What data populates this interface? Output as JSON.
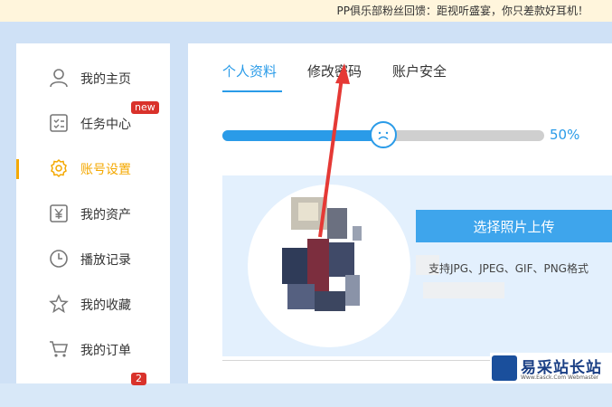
{
  "banner": {
    "text": "PP俱乐部粉丝回馈：距视听盛宴，你只差款好耳机！"
  },
  "sidebar": {
    "items": [
      {
        "label": "我的主页",
        "icon": "user-icon"
      },
      {
        "label": "任务中心",
        "icon": "task-list-icon",
        "badge": "new"
      },
      {
        "label": "账号设置",
        "icon": "gear-icon",
        "active": true
      },
      {
        "label": "我的资产",
        "icon": "yuan-wallet-icon"
      },
      {
        "label": "播放记录",
        "icon": "clock-icon"
      },
      {
        "label": "我的收藏",
        "icon": "star-icon"
      },
      {
        "label": "我的订单",
        "icon": "cart-icon"
      }
    ],
    "partial_badge": "2"
  },
  "main": {
    "tabs": [
      {
        "label": "个人资料",
        "active": true
      },
      {
        "label": "修改密码"
      },
      {
        "label": "账户安全"
      }
    ],
    "progress": {
      "value": 0.5,
      "label": "50%"
    },
    "upload": {
      "button_label": "选择照片上传",
      "formats_text": "支持JPG、JPEG、GIF、PNG格式"
    }
  },
  "watermark": {
    "name": "易采站长站",
    "sub": "Www.Easck.Com Webmaster"
  },
  "colors": {
    "accent": "#2a9be8",
    "active": "#f4a800",
    "badge": "#d9322b",
    "arrow": "#e53935"
  }
}
